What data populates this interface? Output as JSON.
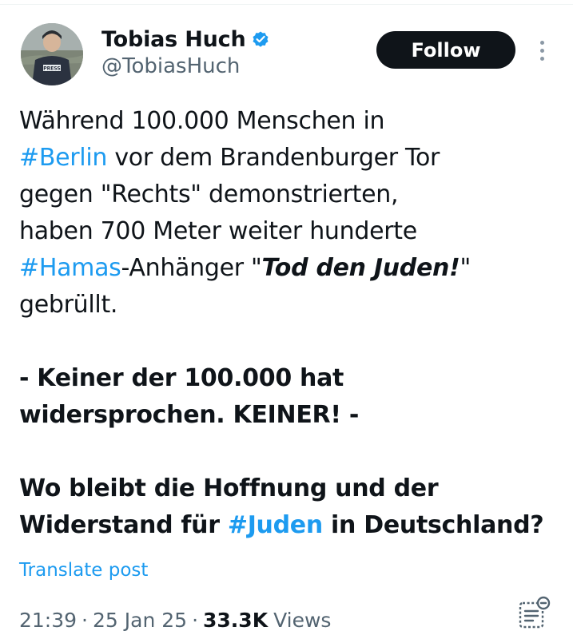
{
  "author": {
    "display_name": "Tobias Huch",
    "handle": "@TobiasHuch",
    "verified_icon": "verified-badge-icon",
    "avatar_icon": "avatar-photo"
  },
  "follow_button": {
    "label": "Follow"
  },
  "more_menu": {
    "icon": "more-vertical-icon"
  },
  "tweet": {
    "l1": {
      "t": "Während 100.000 Menschen in"
    },
    "l2": {
      "tag": "#Berlin",
      "rest": " vor dem Brandenburger Tor"
    },
    "l3": {
      "t": "gegen \"Rechts\" demonstrierten,"
    },
    "l4": {
      "t": "haben 700 Meter weiter hunderte"
    },
    "l5": {
      "tag": "#Hamas",
      "mid": "-Anhänger \"",
      "emph": "Tod den Juden!",
      "end": "\""
    },
    "l6": {
      "t": "gebrüllt."
    },
    "l7": {
      "t": "- Keiner der 100.000 hat"
    },
    "l8": {
      "t": "widersprochen. KEINER! -"
    },
    "l9": {
      "t": "Wo bleibt die Hoffnung und der"
    },
    "l10": {
      "pre": "Widerstand für ",
      "tag": "#Juden",
      "post": " in Deutschland?"
    }
  },
  "translate_link": {
    "label": "Translate post"
  },
  "meta": {
    "time": "21:39",
    "sep": "·",
    "date": "25 Jan 25",
    "views_count": "33.3K",
    "views_label": "Views"
  },
  "notes_icon": "community-notes-icon",
  "colors": {
    "link": "#1d9bf0",
    "text": "#0f1419",
    "secondary": "#536471",
    "follow_bg": "#0f1419"
  }
}
